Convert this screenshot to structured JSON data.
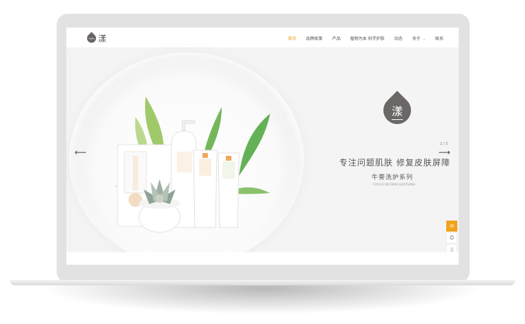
{
  "logo": {
    "mark_text": "YANG",
    "text": "漾"
  },
  "nav": {
    "items": [
      {
        "label": "首页",
        "active": true
      },
      {
        "label": "品牌故事",
        "active": false
      },
      {
        "label": "产品",
        "active": false
      },
      {
        "label": "植物为本 科学护肤",
        "active": false
      },
      {
        "label": "动态",
        "active": false
      },
      {
        "label": "关于",
        "active": false,
        "has_dropdown": true
      },
      {
        "label": "联系",
        "active": false
      }
    ],
    "dropdown_caret": "⌄"
  },
  "hero": {
    "pager": "1 / 3",
    "arrow_left": "⟵",
    "arrow_right": "⟶",
    "brand_char": "漾",
    "headline": "专注问题肌肤  修复皮肤屏障",
    "subline": "牛蒡洗护系列",
    "tagline": "FOCUS ON SKIN SOOTHING"
  },
  "side_tools": [
    {
      "icon": "chat-icon",
      "glyph": "✉"
    },
    {
      "icon": "wechat-icon",
      "glyph": "☺"
    },
    {
      "icon": "phone-icon",
      "glyph": "▯"
    }
  ],
  "colors": {
    "accent": "#f0a21c",
    "logo_gray": "#6b6766",
    "text": "#555555"
  }
}
